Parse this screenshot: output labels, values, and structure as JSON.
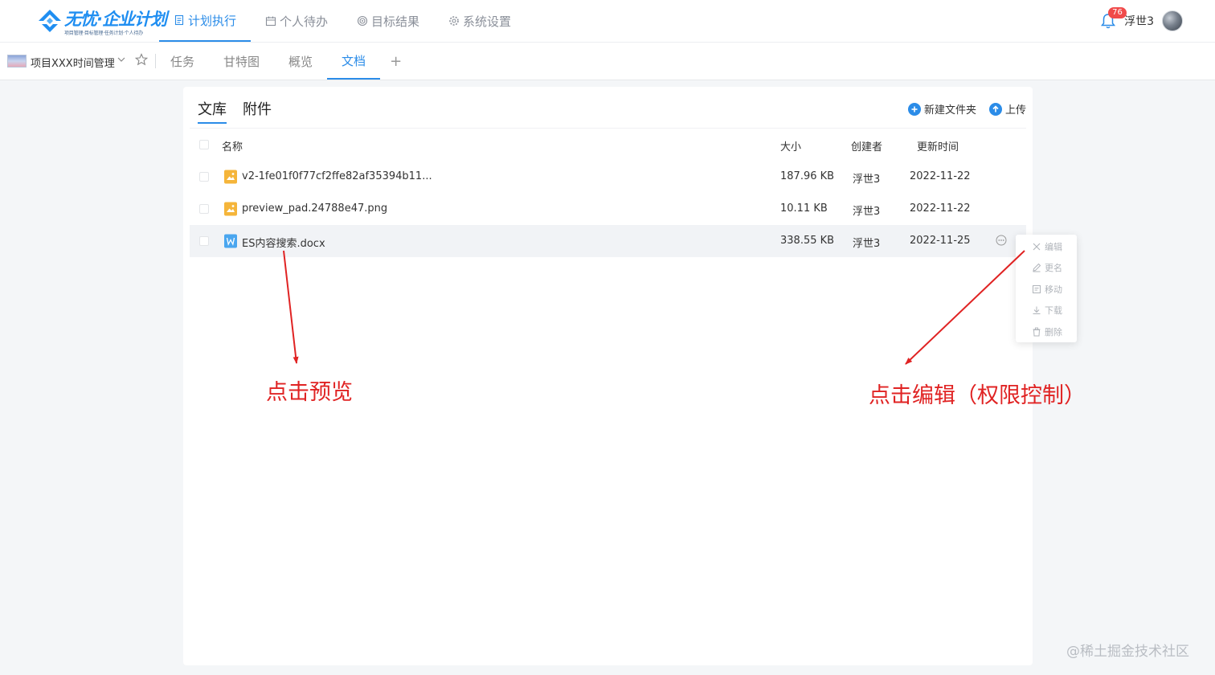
{
  "header": {
    "logo_title": "无忧·企业计划",
    "logo_subtitle": "项目管理·目标管理·任务计划·个人待办",
    "nav": [
      {
        "label": "计划执行",
        "icon": "document-icon",
        "active": true
      },
      {
        "label": "个人待办",
        "icon": "calendar-icon",
        "active": false
      },
      {
        "label": "目标结果",
        "icon": "target-icon",
        "active": false
      },
      {
        "label": "系统设置",
        "icon": "gear-icon",
        "active": false
      }
    ],
    "notification_count": "76",
    "username": "浮世3"
  },
  "project_bar": {
    "project_name": "项目XXX时间管理",
    "tabs": [
      {
        "label": "任务",
        "active": false
      },
      {
        "label": "甘特图",
        "active": false
      },
      {
        "label": "概览",
        "active": false
      },
      {
        "label": "文档",
        "active": true
      }
    ],
    "add_tab_label": "+"
  },
  "docs": {
    "tabs": [
      {
        "label": "文库",
        "active": true
      },
      {
        "label": "附件",
        "active": false
      }
    ],
    "new_folder_label": "新建文件夹",
    "upload_label": "上传",
    "columns": {
      "name": "名称",
      "size": "大小",
      "creator": "创建者",
      "updated": "更新时间"
    },
    "files": [
      {
        "name": "v2-1fe01f0f77cf2ffe82af35394b11...",
        "type": "image",
        "size": "187.96 KB",
        "creator": "浮世3",
        "updated": "2022-11-22"
      },
      {
        "name": "preview_pad.24788e47.png",
        "type": "image",
        "size": "10.11 KB",
        "creator": "浮世3",
        "updated": "2022-11-22"
      },
      {
        "name": "ES内容搜索.docx",
        "type": "word",
        "size": "338.55 KB",
        "creator": "浮世3",
        "updated": "2022-11-25"
      }
    ]
  },
  "context_menu": {
    "items": [
      {
        "label": "编辑",
        "icon": "edit-cross-icon"
      },
      {
        "label": "更名",
        "icon": "pencil-icon"
      },
      {
        "label": "移动",
        "icon": "move-icon"
      },
      {
        "label": "下载",
        "icon": "download-icon"
      },
      {
        "label": "删除",
        "icon": "trash-icon"
      }
    ]
  },
  "annotations": {
    "preview": "点击预览",
    "edit": "点击编辑（权限控制）",
    "color": "#e02323"
  },
  "watermark": "@稀土掘金技术社区",
  "colors": {
    "accent": "#2b8ce8",
    "badge": "#f04a4a",
    "file_image": "#f5b53a",
    "file_word": "#4aa6ef"
  }
}
